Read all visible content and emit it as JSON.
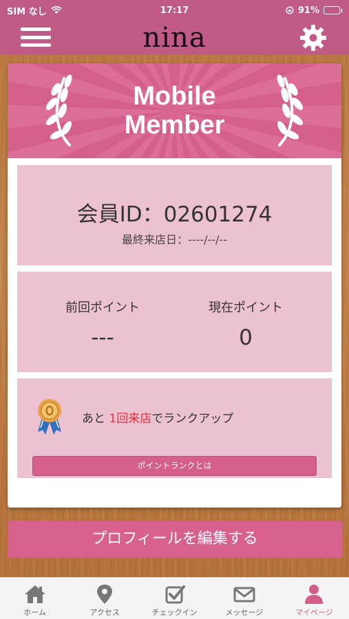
{
  "status_bar": {
    "carrier": "SIM なし",
    "time": "17:17",
    "battery": "91%",
    "battery_level": 0.91
  },
  "header": {
    "app_name": "nina"
  },
  "member_card": {
    "banner_title_line1": "Mobile",
    "banner_title_line2": "Member",
    "member_id": "会員ID：02601274",
    "last_visit": "最終来店日：----/--/--",
    "previous_points_label": "前回ポイント",
    "previous_points_value": "---",
    "current_points_label": "現在ポイント",
    "current_points_value": "0",
    "rankup_prefix": "あと ",
    "rankup_highlight": "1回来店",
    "rankup_suffix": "でランクアップ",
    "rank_info_button": "ポイントランクとは"
  },
  "edit_profile_button": "プロフィールを編集する",
  "tab_bar": {
    "active_color": "#d45f8d",
    "tabs": [
      {
        "label": "ホーム",
        "icon": "home-icon"
      },
      {
        "label": "アクセス",
        "icon": "map-pin-icon"
      },
      {
        "label": "チェックイン",
        "icon": "checkbox-icon"
      },
      {
        "label": "メッセージ",
        "icon": "envelope-icon"
      },
      {
        "label": "マイページ",
        "icon": "person-icon"
      }
    ]
  },
  "colors": {
    "primary_pink": "#c05a86",
    "banner_pink": "#d45f8d",
    "panel_pink": "#ecc2d2",
    "highlight_red": "#e0323f"
  }
}
